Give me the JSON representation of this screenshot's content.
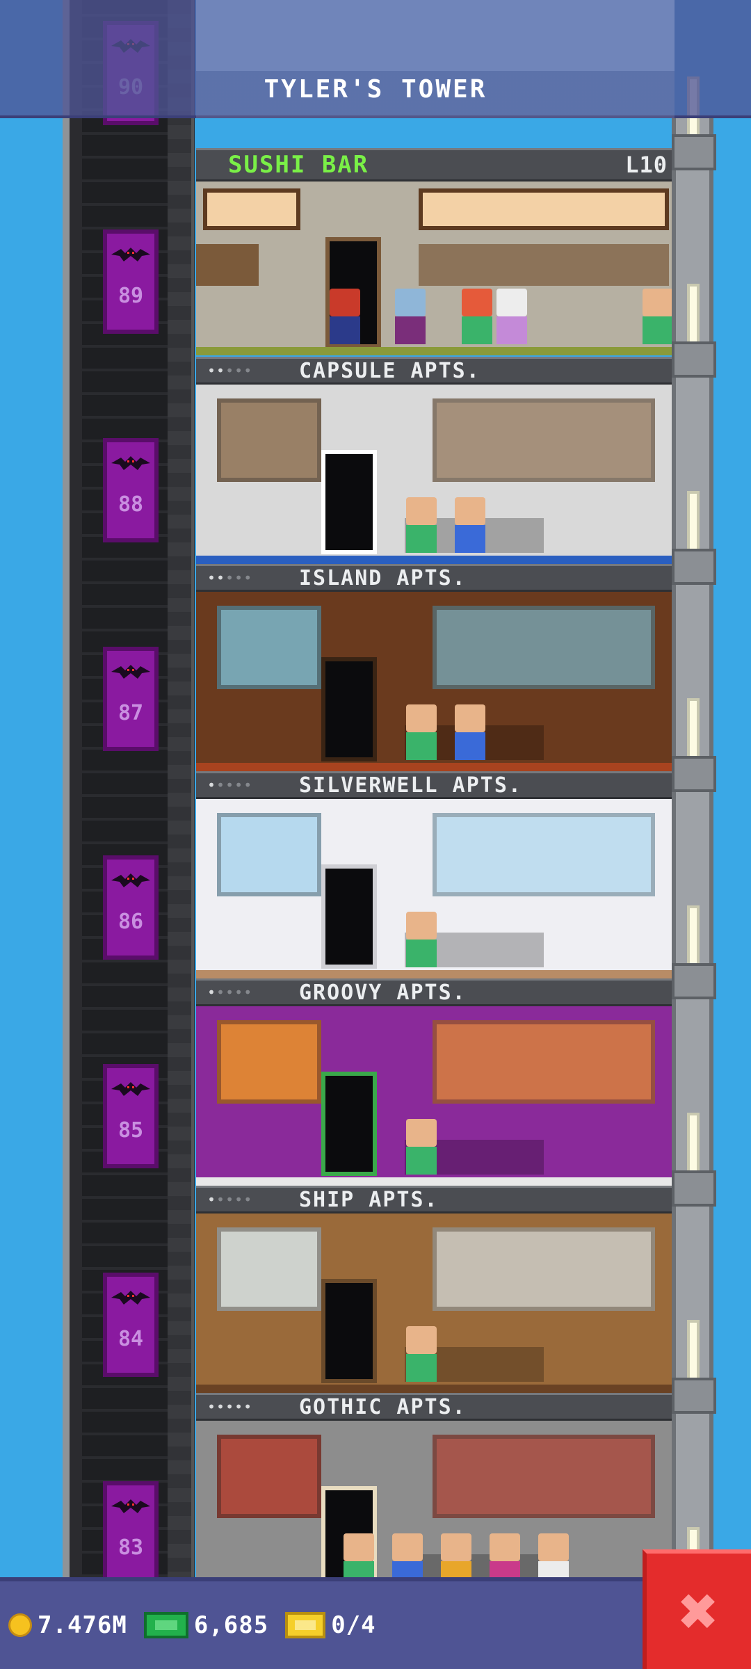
{
  "header": {
    "title": "TYLER'S TOWER"
  },
  "top_floor": {
    "name": "SUSHI BAR",
    "level": "L10",
    "name_color": "#7af047"
  },
  "elevator": {
    "color": "#8a1aa0",
    "floor_numbers": [
      "90",
      "89",
      "88",
      "87",
      "86",
      "85",
      "84",
      "83"
    ]
  },
  "floors": [
    {
      "people": "•••••",
      "occupied": 2,
      "name": "CAPSULE APTS.",
      "theme": "capsule"
    },
    {
      "people": "•••••",
      "occupied": 2,
      "name": "ISLAND APTS.",
      "theme": "island"
    },
    {
      "people": "•••••",
      "occupied": 1,
      "name": "SILVERWELL APTS.",
      "theme": "silverwell"
    },
    {
      "people": "•••••",
      "occupied": 1,
      "name": "GROOVY APTS.",
      "theme": "groovy"
    },
    {
      "people": "•••••",
      "occupied": 1,
      "name": "SHIP APTS.",
      "theme": "ship"
    },
    {
      "people": "•••••",
      "occupied": 5,
      "name": "GOTHIC APTS.",
      "theme": "gothic"
    }
  ],
  "footer": {
    "coins": "7.476M",
    "bux": "6,685",
    "tickets": "0/4",
    "close_icon": "close-icon"
  }
}
